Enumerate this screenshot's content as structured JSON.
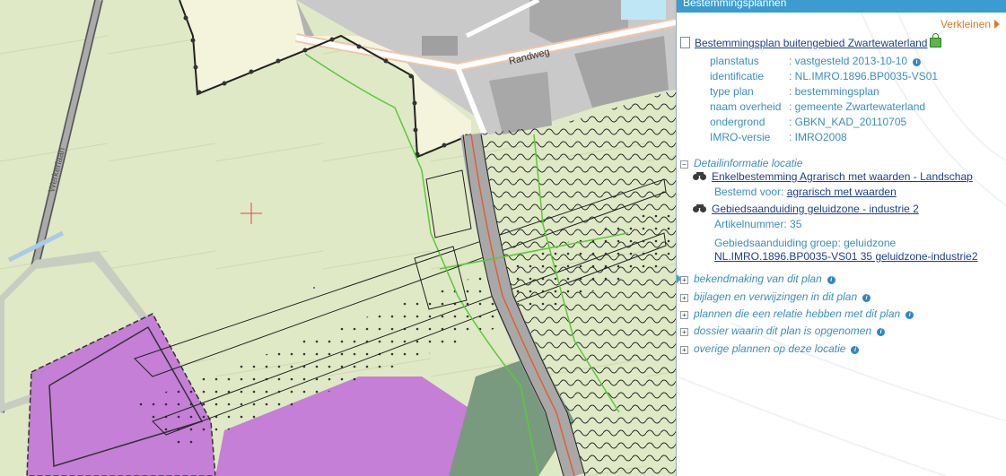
{
  "map": {
    "street_name": "Randweg",
    "rail_street_name_1": "Werkerlaan",
    "rail_street_name_2": "Werkerlaan"
  },
  "panel": {
    "title": "Bestemmingsplannen",
    "shrink_label": "Verkleinen",
    "plan": {
      "name": "Bestemmingsplan buitengebied Zwartewaterland",
      "properties": [
        {
          "key": "planstatus",
          "value": ": vastgesteld 2013-10-10",
          "info": true
        },
        {
          "key": "identificatie",
          "value": ": NL.IMRO.1896.BP0035-VS01",
          "info": false
        },
        {
          "key": "type plan",
          "value": ": bestemmingsplan",
          "info": false
        },
        {
          "key": "naam overheid",
          "value": ": gemeente Zwartewaterland",
          "info": false
        },
        {
          "key": "ondergrond",
          "value": ": GBKN_KAD_20110705",
          "info": false
        },
        {
          "key": "IMRO-versie",
          "value": ": IMRO2008",
          "info": false
        }
      ]
    },
    "detail_section": {
      "toggle": "−",
      "label": "Detailinformatie locatie",
      "item1": {
        "title": "Enkelbestemming Agrarisch met waarden - Landschap",
        "sub_label": "Bestemd voor: ",
        "sub_link": "agrarisch met waarden"
      },
      "item2": {
        "title": "Gebiedsaanduiding geluidzone - industrie 2",
        "article": "Artikelnummer: 35",
        "group": "Gebiedsaanduiding groep: geluidzone",
        "link": "NL.IMRO.1896.BP0035-VS01 35 geluidzone-industrie2"
      }
    },
    "collapsed_sections": [
      {
        "toggle": "+",
        "label": "bekendmaking van dit plan"
      },
      {
        "toggle": "+",
        "label": "bijlagen en verwijzingen in dit plan"
      },
      {
        "toggle": "+",
        "label": "plannen die een relatie hebben met dit plan"
      },
      {
        "toggle": "+",
        "label": "dossier waarin dit plan is opgenomen"
      },
      {
        "toggle": "+",
        "label": "overige plannen op deze locatie"
      }
    ],
    "info_glyph": "i"
  },
  "colors": {
    "agri": "#dfe9c6",
    "industry_purple": "#c57fd6",
    "built_grey": "#9a9a9a",
    "road_white": "#ffffff",
    "header_blue": "#3c9ccf",
    "link_blue": "#1c3f8f",
    "text_blue": "#3a8ebd",
    "accent_orange": "#e0762a",
    "green_line": "#5ac93a"
  }
}
